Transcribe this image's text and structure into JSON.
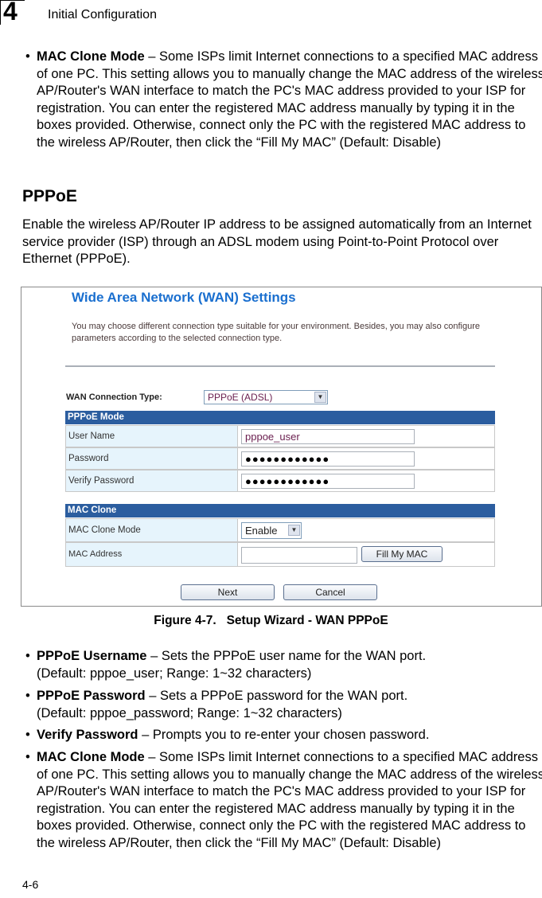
{
  "header": {
    "chapter_number": "4",
    "chapter_title": "Initial Configuration"
  },
  "top_bullet": {
    "term": "MAC Clone Mode",
    "text": " – Some ISPs limit Internet connections to a specified MAC address of one PC. This setting allows you to manually change the MAC address of the wireless AP/Router's WAN interface to match the PC's MAC address provided to your ISP for registration. You can enter the registered MAC address manually by typing it in the boxes provided. Otherwise, connect only the PC with the registered MAC address to the wireless AP/Router, then click the “Fill My MAC” (Default: Disable)"
  },
  "section": {
    "heading": "PPPoE",
    "paragraph": "Enable the wireless AP/Router IP address to be assigned automatically from an Internet service provider (ISP) through an ADSL modem using Point-to-Point Protocol over Ethernet (PPPoE)."
  },
  "screenshot": {
    "title": "Wide Area Network (WAN) Settings",
    "description": "You may choose different connection type suitable for your environment. Besides, you may also configure parameters according to the selected connection type.",
    "wan_type_label": "WAN Connection Type:",
    "wan_type_value": "PPPoE (ADSL)",
    "pppoe_section": "PPPoE Mode",
    "user_name_label": "User Name",
    "user_name_value": "pppoe_user",
    "password_label": "Password",
    "password_value": "●●●●●●●●●●●●",
    "verify_label": "Verify Password",
    "verify_value": "●●●●●●●●●●●●",
    "mac_section": "MAC Clone",
    "mac_mode_label": "MAC Clone Mode",
    "mac_mode_value": "Enable",
    "mac_address_label": "MAC Address",
    "mac_address_value": "",
    "fill_mac_button": "Fill My MAC",
    "next_button": "Next",
    "cancel_button": "Cancel",
    "colors": {
      "title": "#1a6fcf",
      "section_header": "#2b5d9f",
      "label_cell": "#e6f4fc"
    }
  },
  "caption": "Figure 4-7.   Setup Wizard - WAN PPPoE",
  "bullets": [
    {
      "term": "PPPoE Username",
      "text": " – Sets the PPPoE user name for the WAN port.",
      "line2": "(Default: pppoe_user; Range: 1~32 characters)"
    },
    {
      "term": "PPPoE Password",
      "text": " – Sets a PPPoE password for the WAN port.",
      "line2": "(Default: pppoe_password; Range: 1~32 characters)"
    },
    {
      "term": "Verify Password",
      "text": " – Prompts you to re-enter your chosen password.",
      "line2": ""
    },
    {
      "term": "MAC Clone Mode",
      "text": " – Some ISPs limit Internet connections to a specified MAC address of one PC. This setting allows you to manually change the MAC address of the wireless AP/Router's WAN interface to match the PC's MAC address provided to your ISP for registration. You can enter the registered MAC address manually by typing it in the boxes provided. Otherwise, connect only the PC with the registered MAC address to the wireless AP/Router, then click the “Fill My MAC” (Default: Disable)",
      "line2": ""
    }
  ],
  "footer": {
    "page_number": "4-6"
  }
}
